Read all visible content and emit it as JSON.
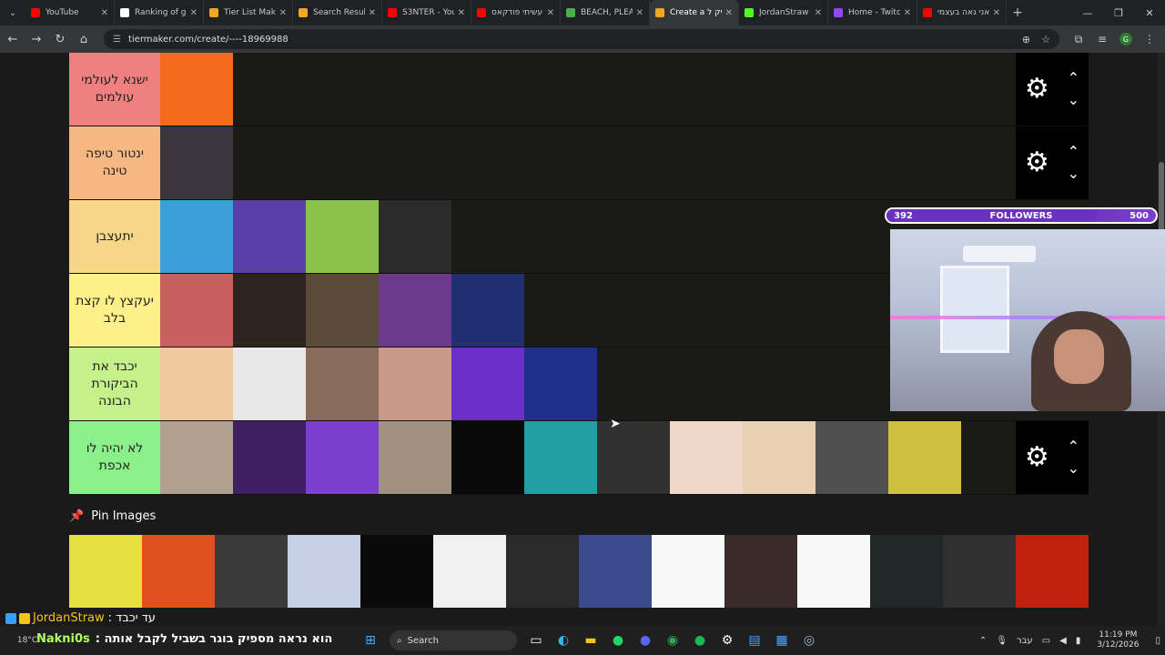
{
  "tabs": [
    {
      "title": "YouTube",
      "color": "#ff0000"
    },
    {
      "title": "Ranking of guy",
      "color": "#ffffff"
    },
    {
      "title": "Tier List Maker",
      "color": "#f5a623"
    },
    {
      "title": "Search Results",
      "color": "#f5a623"
    },
    {
      "title": "S3NTER - YouT",
      "color": "#ff0000"
    },
    {
      "title": "עשיתי פודקאס",
      "color": "#ff0000"
    },
    {
      "title": "BEACH, PLEAS",
      "color": "#4caf50"
    },
    {
      "title": "Create a קיק ל",
      "color": "#f5a623",
      "active": true
    },
    {
      "title": "JordanStraw -",
      "color": "#53fc18"
    },
    {
      "title": "Home - Twitch",
      "color": "#9146ff"
    },
    {
      "title": "אני גאה בעצמי",
      "color": "#ff0000"
    }
  ],
  "address": {
    "url": "tiermaker.com/create/----18969988"
  },
  "tiers": [
    {
      "label": "ישנא לעולמי עולמים",
      "color": "#f08080",
      "items": [
        "#f26b1d"
      ]
    },
    {
      "label": "ינטור טיפה טינה",
      "color": "#f6b882",
      "items": [
        "#3a3640"
      ]
    },
    {
      "label": "יתעצבן",
      "color": "#f6d78a",
      "items": [
        "#3aa0d8",
        "#5b3fa8",
        "#8bc34a",
        "#2b2b2b"
      ]
    },
    {
      "label": "יעקצץ לו קצת בלב",
      "color": "#fdf08a",
      "items": [
        "#c86060",
        "#2d2420",
        "#5a4a3a",
        "#6b3a8a",
        "#1f2f70"
      ]
    },
    {
      "label": "יכבד את הביקורת הבונה",
      "color": "#c6f08a",
      "items": [
        "#f0c8a0",
        "#e8e8e8",
        "#8a6a5a",
        "#c89a8a",
        "#6b2fc8",
        "#1f2f8a"
      ]
    },
    {
      "label": "לא יהיה לו אכפת",
      "color": "#8af08a",
      "items": [
        "#b0a090",
        "#402060",
        "#7b3fd0",
        "#a09080",
        "#0a0a0a",
        "#20a0a0",
        "#303030",
        "#f0d8c8",
        "#e8d0b0",
        "#505050",
        "#d0c040"
      ]
    }
  ],
  "pin": {
    "label": "Pin Images",
    "items": [
      "#e8e040",
      "#e05020",
      "#3a3a3a",
      "#c8d0e8",
      "#0a0a0a",
      "#f0f0f0",
      "#2a2a2a",
      "#3a4a8a",
      "#f8f8f8",
      "#3a2a2a",
      "#f8f8f8",
      "#202828",
      "#303030",
      "#c02010"
    ]
  },
  "followers": {
    "current": "392",
    "label": "FOLLOWERS",
    "goal": "500",
    "progress": 0.784
  },
  "chat": {
    "line1_user": "JordanStraw",
    "line1_msg": ": עד יכבד",
    "line2_user": "Nakni0s",
    "line2_msg": ": הוא נראה מספיק בוגר בשביל לקבל אותה"
  },
  "taskbar": {
    "weather_temp": "18°C",
    "search_placeholder": "Search",
    "language": "עבר",
    "time": "11:19 PM",
    "date": "3/12/2026"
  }
}
